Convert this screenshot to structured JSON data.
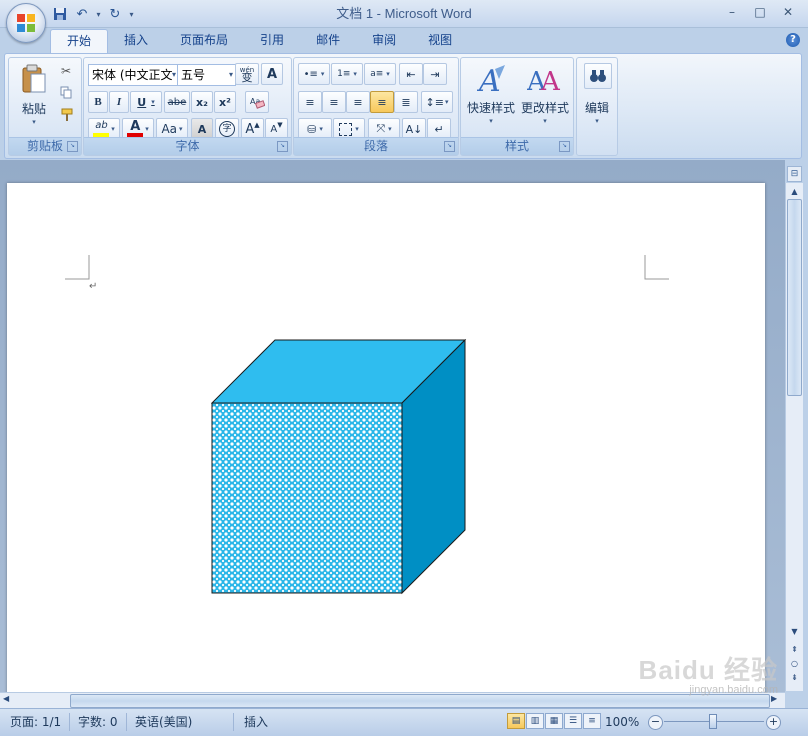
{
  "window": {
    "title": "文档 1 - Microsoft Word",
    "minimize": "–",
    "maximize": "□",
    "close": "✕"
  },
  "tabs": [
    "开始",
    "插入",
    "页面布局",
    "引用",
    "邮件",
    "审阅",
    "视图"
  ],
  "help": "?",
  "clipboard": {
    "paste_label": "粘贴",
    "group_label": "剪贴板"
  },
  "font": {
    "font_name": "宋体 (中文正文",
    "font_size": "五号",
    "group_label": "字体",
    "bold": "B",
    "italic": "I",
    "underline": "U",
    "strike": "abe",
    "subscript": "x₂",
    "superscript": "x²",
    "change_case": "Aa",
    "grow": "A",
    "shrink": "A",
    "phonetic": "wén",
    "border_char": "A",
    "enclose": "字"
  },
  "paragraph": {
    "group_label": "段落"
  },
  "styles": {
    "quick_styles_label": "快速样式",
    "change_styles_label": "更改样式",
    "group_label": "样式"
  },
  "editing": {
    "label": "编辑"
  },
  "status": {
    "page": "页面: 1/1",
    "words": "字数: 0",
    "language": "英语(美国)",
    "insert_mode": "插入",
    "zoom": "100%"
  },
  "document": {
    "paragraph_mark": "↵"
  },
  "watermark": {
    "brand": "Baidu 经验",
    "url": "jingyan.baidu.com"
  },
  "colors": {
    "cube_top": "#2fbdef",
    "cube_right": "#008fc4",
    "cube_front_bg": "#2ab6e8",
    "highlight": "#ffff00",
    "font_color": "#e00000"
  }
}
